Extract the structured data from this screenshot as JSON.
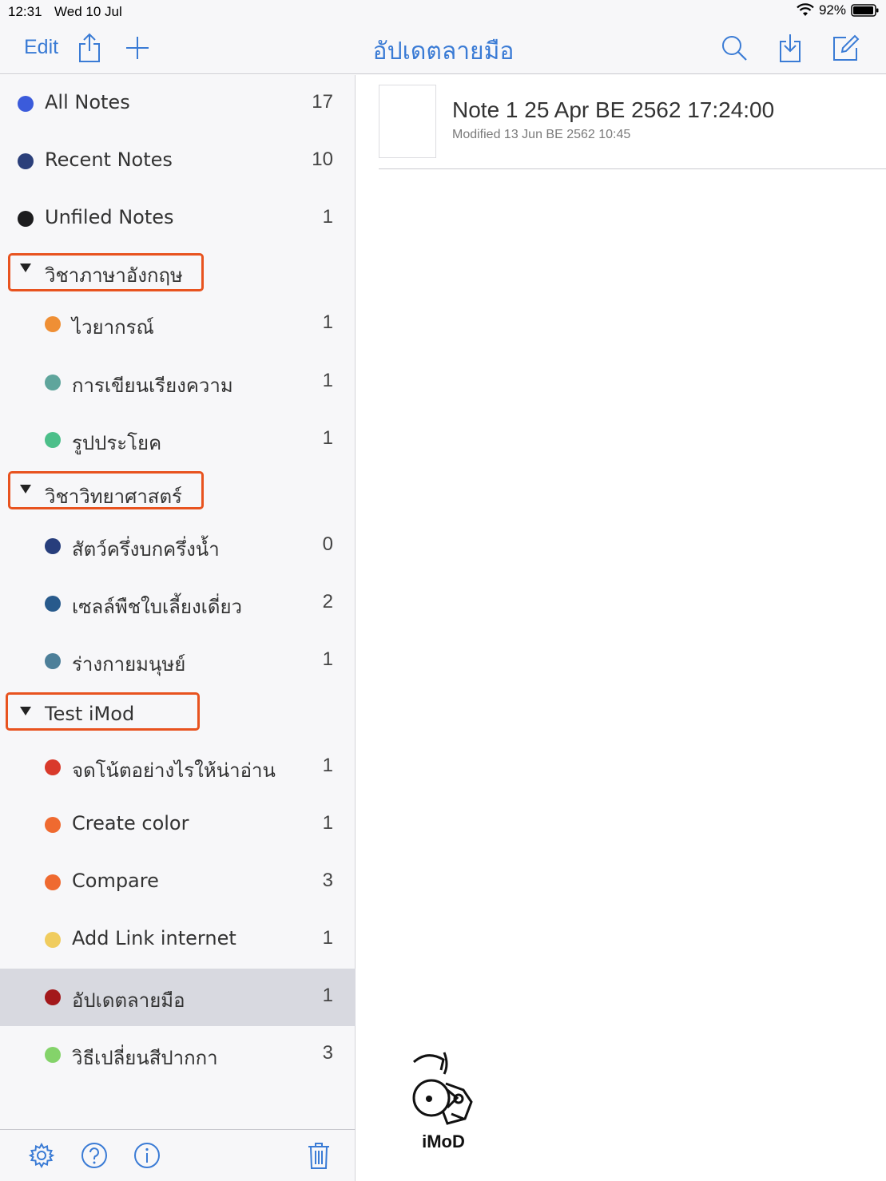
{
  "status_bar": {
    "time": "12:31",
    "date": "Wed 10 Jul",
    "battery": "92%"
  },
  "nav": {
    "edit_label": "Edit",
    "title": "อัปเดตลายมือ",
    "icons": [
      "share-icon",
      "plus-icon",
      "search-icon",
      "import-icon",
      "compose-icon"
    ]
  },
  "sidebar": {
    "top_items": [
      {
        "label": "All Notes",
        "count": "17",
        "color": "#3b5bdb"
      },
      {
        "label": "Recent Notes",
        "count": "10",
        "color": "#2b3f7a"
      },
      {
        "label": "Unfiled Notes",
        "count": "1",
        "color": "#1c1c1e"
      }
    ],
    "groups": [
      {
        "label": "วิชาภาษาอังกฤษ",
        "items": [
          {
            "label": "ไวยากรณ์",
            "count": "1",
            "color": "#ef8f35"
          },
          {
            "label": "การเขียนเรียงความ",
            "count": "1",
            "color": "#5fa59c"
          },
          {
            "label": "รูปประโยค",
            "count": "1",
            "color": "#4cbf8a"
          }
        ]
      },
      {
        "label": "วิชาวิทยาศาสตร์",
        "items": [
          {
            "label": "สัตว์ครึ่งบกครึ่งน้ำ",
            "count": "0",
            "color": "#273e7c"
          },
          {
            "label": "เซลล์พืชใบเลี้ยงเดี่ยว",
            "count": "2",
            "color": "#285a8c"
          },
          {
            "label": "ร่างกายมนุษย์",
            "count": "1",
            "color": "#4d7f99"
          }
        ]
      },
      {
        "label": "Test iMod",
        "items": [
          {
            "label": "จดโน้ตอย่างไรให้น่าอ่าน",
            "count": "1",
            "color": "#d93a2b"
          },
          {
            "label": "Create color",
            "count": "1",
            "color": "#ef6a30"
          },
          {
            "label": "Compare",
            "count": "3",
            "color": "#ef6a30"
          },
          {
            "label": "Add Link internet",
            "count": "1",
            "color": "#f0cc5e"
          },
          {
            "label": "อัปเดตลายมือ",
            "count": "1",
            "color": "#a3181b",
            "selected": true
          },
          {
            "label": "วิธีเปลี่ยนสีปากกา",
            "count": "3",
            "color": "#84d36a"
          }
        ]
      }
    ]
  },
  "bottom_bar": {
    "icons": [
      "settings-icon",
      "help-icon",
      "info-icon",
      "trash-icon"
    ]
  },
  "note": {
    "title": "Note 1 25 Apr BE 2562 17:24:00",
    "modified": "Modified 13 Jun BE 2562 10:45"
  },
  "watermark": {
    "text": "iMoD"
  },
  "accent_color": "#3a7bd5",
  "highlight_color": "#e8531f"
}
